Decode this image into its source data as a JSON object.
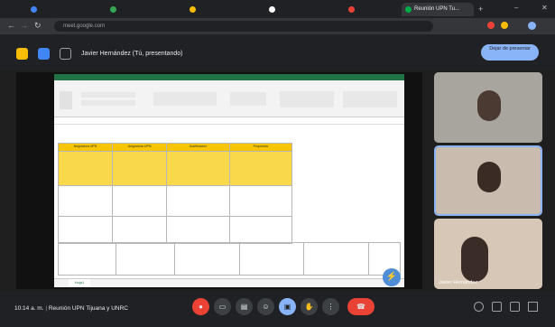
{
  "browser": {
    "tabs": [
      {
        "label": "",
        "active": false
      },
      {
        "label": "",
        "active": false
      },
      {
        "label": "",
        "active": false
      },
      {
        "label": "",
        "active": false
      },
      {
        "label": "",
        "active": false
      },
      {
        "label": "Reunión UPN Tu...",
        "active": true
      }
    ],
    "address": "meet.google.com"
  },
  "meet": {
    "presenter_label": "Javier Hernández (Tú, presentando)",
    "stop_presenting": "Dejar de presentar",
    "meeting_time": "10:14 a. m.",
    "meeting_name": "Reunión UPN Tijuana y UNRC"
  },
  "participants": [
    {
      "name": ""
    },
    {
      "name": ""
    },
    {
      "name": "Javier Hernández"
    }
  ],
  "spreadsheet": {
    "headers": [
      "Asignatura UPN",
      "Asignatura UPN",
      "Justificación",
      "Propuesta"
    ],
    "sheet_tab": "Hoja1"
  },
  "icons": {
    "mic": "mic-off-icon",
    "camera": "camera-icon",
    "captions": "captions-icon",
    "emoji": "emoji-icon",
    "present": "present-icon",
    "hand": "hand-icon",
    "more": "more-icon",
    "end": "end-call-icon"
  },
  "colors": {
    "accent": "#8ab4f8",
    "end_call": "#ea4335",
    "excel_green": "#217346",
    "highlight": "#f7c600"
  }
}
